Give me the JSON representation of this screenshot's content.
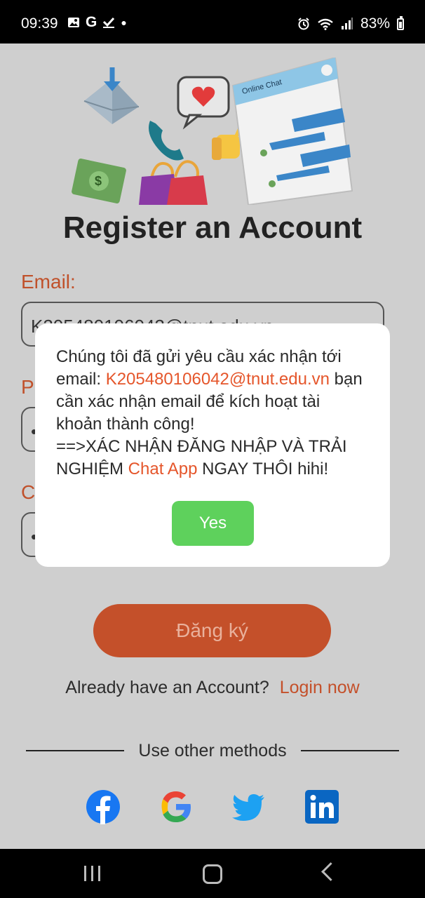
{
  "status_bar": {
    "time": "09:39",
    "battery": "83%",
    "left_icons": [
      "image-icon",
      "google-icon",
      "check-icon",
      "dot-icon"
    ],
    "right_icons": [
      "alarm-icon",
      "wifi-icon",
      "signal-icon",
      "battery-icon"
    ]
  },
  "hero": {
    "chat_window_title": "Online Chat"
  },
  "form": {
    "title": "Register an Account",
    "email_label": "Email:",
    "email_value": "K205480106042@tnut.edu.vn",
    "password_label_partial": "P",
    "password_value_partial": "•",
    "confirm_label_partial": "C",
    "confirm_value_partial": "•",
    "register_button": "Đăng ký",
    "have_account_text": "Already have an Account?",
    "login_link": "Login now",
    "other_methods_text": "Use other methods",
    "social": [
      "facebook-icon",
      "google-icon",
      "twitter-icon",
      "linkedin-icon"
    ]
  },
  "dialog": {
    "line1": "Chúng tôi đã gửi yêu cầu xác nhận tới email: ",
    "email": "K205480106042@tnut.edu.vn",
    "line2": " bạn cần xác nhận email để kích hoạt tài khoản thành công!",
    "line3": "==>XÁC NHẬN ĐĂNG NHẬP VÀ TRẢI NGHIỆM ",
    "app_name": "Chat App",
    "line4": " NGAY THÔI hihi!",
    "yes_button": "Yes"
  },
  "colors": {
    "accent": "#c4502a",
    "dialog_accent": "#e5562b",
    "yes_green": "#5ed15c",
    "background": "#cfcfcf"
  }
}
